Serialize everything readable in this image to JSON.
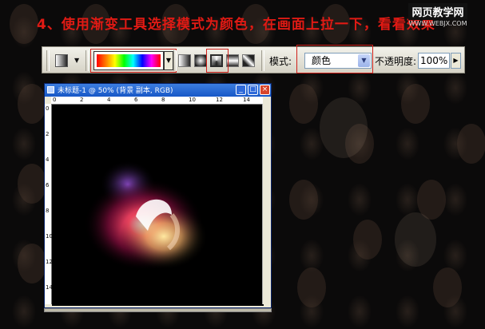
{
  "caption": "4、使用渐变工具选择模式为颜色，在画面上拉一下，看看效果",
  "watermark": {
    "line1": "网页教学网",
    "line2": "WWW.WEBJX.COM"
  },
  "toolbar": {
    "tool_icon": "gradient-tool-icon",
    "gradient_preset": "spectrum",
    "gradient_types": [
      {
        "name": "linear-gradient-icon",
        "selected": false
      },
      {
        "name": "radial-gradient-icon",
        "selected": false
      },
      {
        "name": "angle-gradient-icon",
        "selected": true
      },
      {
        "name": "reflected-gradient-icon",
        "selected": false
      },
      {
        "name": "diamond-gradient-icon",
        "selected": false
      }
    ],
    "mode_label": "模式:",
    "mode_value": "颜色",
    "opacity_label": "不透明度:",
    "opacity_value": "100%"
  },
  "document": {
    "title": "未标题-1 @ 50% (背景 副本, RGB)",
    "ruler_numbers": [
      "0",
      "2",
      "4",
      "6",
      "8",
      "10",
      "12",
      "14"
    ],
    "ruler_left_numbers": [
      "0",
      "2",
      "4",
      "6",
      "8",
      "10",
      "12",
      "14"
    ],
    "buttons": {
      "minimize": "_",
      "maximize": "□",
      "close": "×"
    }
  },
  "colors": {
    "accent_red": "#d0201a",
    "caption_red": "#e01a14",
    "titlebar_blue": "#1757c7"
  }
}
